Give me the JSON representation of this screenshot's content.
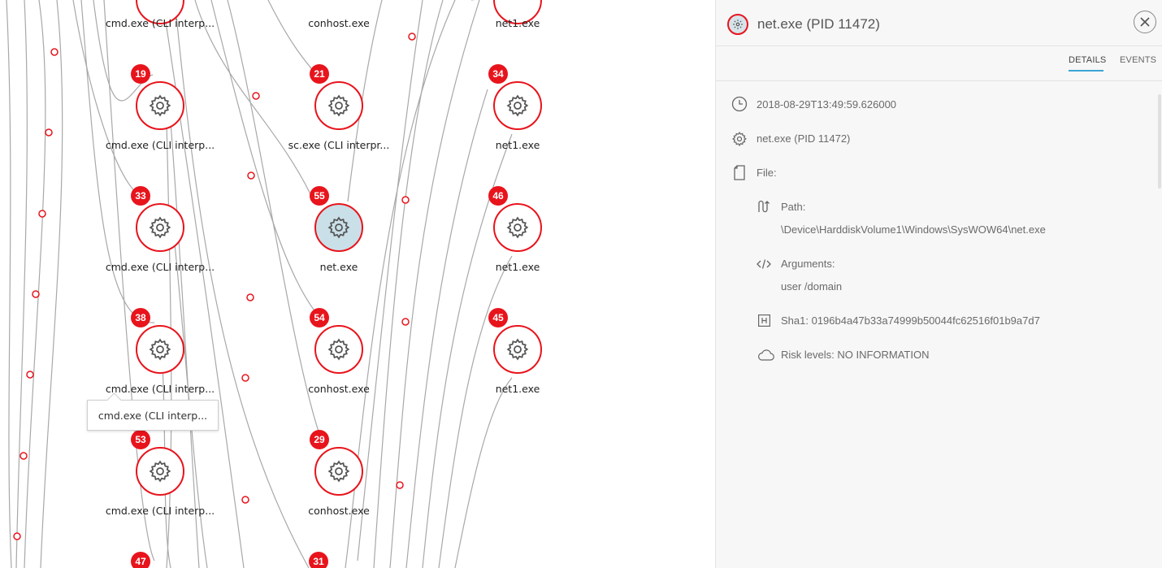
{
  "graph": {
    "nodes": [
      {
        "label": "cmd.exe (CLI interp...",
        "badge": "19"
      },
      {
        "label": "sc.exe (CLI interpr...",
        "badge": "21"
      },
      {
        "label": "net1.exe",
        "badge": "34"
      },
      {
        "label": "cmd.exe (CLI interp...",
        "badge": "33"
      },
      {
        "label": "net.exe",
        "badge": "55"
      },
      {
        "label": "net1.exe",
        "badge": "46"
      },
      {
        "label": "cmd.exe (CLI interp...",
        "badge": "38"
      },
      {
        "label": "conhost.exe",
        "badge": "54"
      },
      {
        "label": "net1.exe",
        "badge": "45"
      },
      {
        "label": "cmd.exe (CLI interp...",
        "badge": "53"
      },
      {
        "label": "conhost.exe",
        "badge": "29"
      }
    ],
    "top_labels": [
      "cmd.exe (CLI interp...",
      "conhost.exe",
      "net1.exe"
    ],
    "bottom_badges": [
      "47",
      "31"
    ],
    "tooltip": "cmd.exe (CLI interp...",
    "colors": {
      "node_border": "#e8141c",
      "selected_fill": "#c9e0e8",
      "edge": "#a8a8a8"
    }
  },
  "panel": {
    "title": "net.exe (PID 11472)",
    "tabs": [
      "DETAILS",
      "EVENTS"
    ],
    "active_tab": "DETAILS",
    "timestamp": "2018-08-29T13:49:59.626000",
    "process": "net.exe (PID 11472)",
    "file_label": "File:",
    "path_label": "Path:",
    "path_value": "\\Device\\HarddiskVolume1\\Windows\\SysWOW64\\net.exe",
    "arguments_label": "Arguments:",
    "arguments_value": "user /domain",
    "sha1": "Sha1: 0196b4a47b33a74999b50044fc62516f01b9a7d7",
    "risk": "Risk levels: NO INFORMATION",
    "icons": [
      "clock-icon",
      "gear-icon",
      "file-icon",
      "path-icon",
      "code-icon",
      "hash-icon",
      "cloud-icon",
      "close-icon"
    ],
    "accent": "#3aa4d6"
  }
}
